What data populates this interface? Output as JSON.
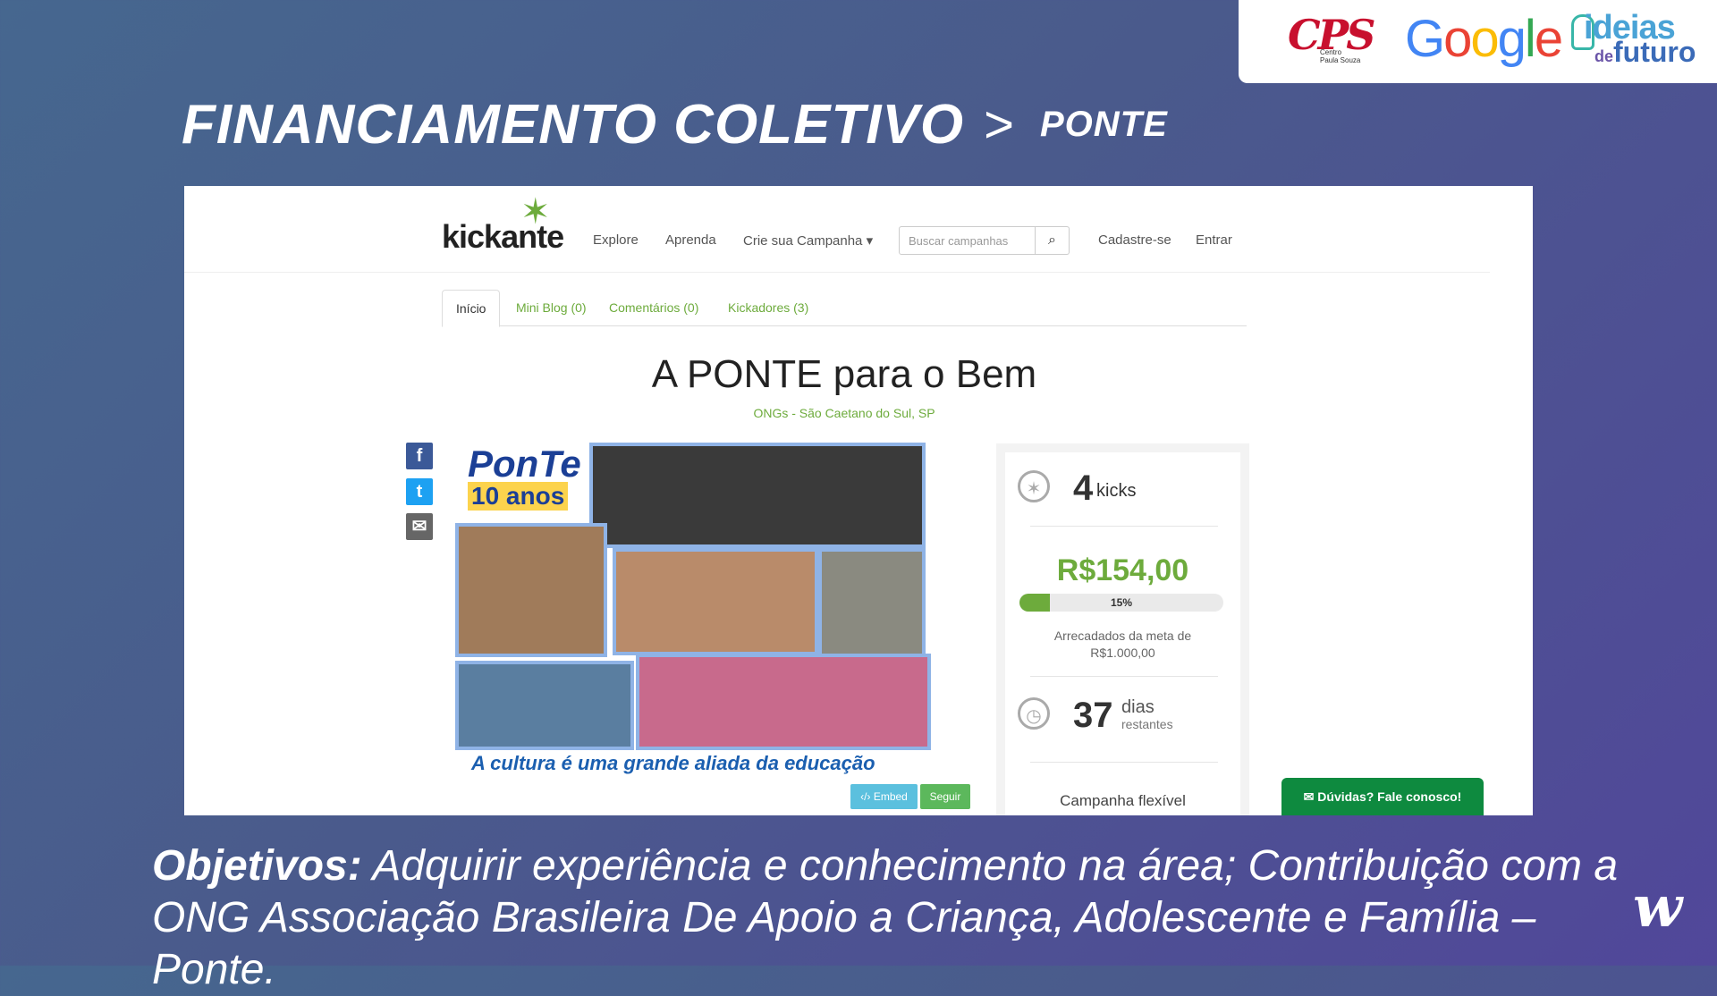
{
  "header": {
    "title": "FINANCIAMENTO COLETIVO",
    "separator": ">",
    "subtitle": "PONTE"
  },
  "logos": {
    "cps": "CPS",
    "cps_sub_line1": "Centro",
    "cps_sub_line2": "Paula Souza",
    "google_letters": [
      "G",
      "o",
      "o",
      "g",
      "l",
      "e"
    ],
    "google_colors": [
      "#4285F4",
      "#EA4335",
      "#FBBC05",
      "#4285F4",
      "#34A853",
      "#EA4335"
    ],
    "ideias_top": "ideias",
    "ideias_de": "de",
    "ideias_bottom": "futuro",
    "corner_logo": "w"
  },
  "site": {
    "brand": "kickante",
    "nav": {
      "explore": "Explore",
      "aprenda": "Aprenda",
      "crie": "Crie sua Campanha ▾",
      "search_placeholder": "Buscar campanhas",
      "cadastre": "Cadastre-se",
      "entrar": "Entrar"
    },
    "tabs": [
      "Início",
      "Mini Blog (0)",
      "Comentários (0)",
      "Kickadores (3)"
    ],
    "campaign": {
      "title": "A PONTE para o Bem",
      "location": "ONGs - São Caetano do Sul, SP",
      "image_logo": "PonTe",
      "image_anos": "10 anos",
      "image_caption": "A cultura é uma grande aliada da educação",
      "embed_label": "‹/› Embed",
      "follow_label": "Seguir"
    },
    "stats": {
      "kicks_count": "4",
      "kicks_label": "kicks",
      "amount": "R$154,00",
      "progress_percent": 15,
      "progress_label": "15%",
      "goal_line1": "Arrecadados da meta de",
      "goal_line2": "R$1.000,00",
      "days": "37",
      "days_label": "dias",
      "days_sub": "restantes",
      "campaign_type": "Campanha flexível"
    },
    "chat_label": "Dúvidas? Fale conosco!"
  },
  "footer": {
    "objetivos_label": "Objetivos:",
    "objetivos_text": " Adquirir experiência e conhecimento na área; Contribuição com a ONG Associação Brasileira De Apoio a Criança, Adolescente e Família – Ponte."
  },
  "icons": {
    "facebook": "facebook-icon",
    "twitter": "twitter-icon",
    "email": "email-icon",
    "search": "search-icon",
    "kicks": "kick-icon",
    "clock": "clock-icon",
    "chat": "envelope-icon"
  },
  "colors": {
    "brand_green": "#6dab3c",
    "chat_green": "#0e8a3f",
    "facebook": "#3b5998",
    "twitter": "#1da1f2"
  }
}
